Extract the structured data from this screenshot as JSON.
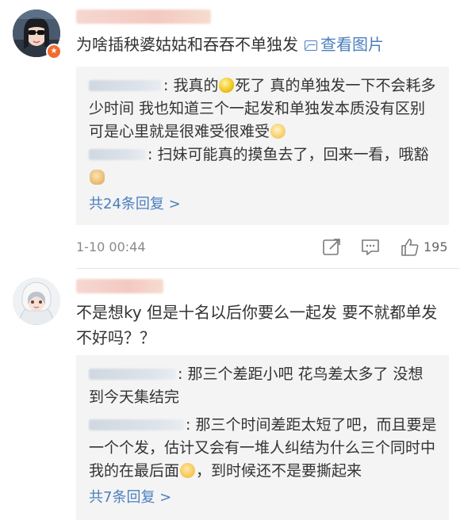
{
  "comments": [
    {
      "text": "为啥插秧婆姑姑和吞吞不单独发",
      "view_image_label": "查看图片",
      "replies": [
        {
          "text_before_emoji": "我真的",
          "emoji": "lemon-emoji",
          "text_after_emoji": "死了 真的单独发一下不会耗多少时间 我也知道三个一起发和单独发本质没有区别 可是心里就是很难受很难受",
          "emoji_end": "shy-emoji"
        },
        {
          "text": "扫妹可能真的摸鱼去了，回来一看，哦豁",
          "emoji_end": "doge-emoji"
        }
      ],
      "more_replies": "共24条回复 >",
      "timestamp": "1-10 00:44",
      "like_count": "195"
    },
    {
      "text": "不是想ky 但是十名以后你要么一起发 要不就都单发不好吗？？",
      "replies": [
        {
          "text": "那三个差距小吧 花鸟差太多了 没想到今天集结完"
        },
        {
          "text_before_emoji": "那三个时间差距太短了吧，而且要是一个个发，估计又会有一堆人纠结为什么三个同时中我的在最后面",
          "emoji": "drool-emoji",
          "text_after_emoji": "，到时候还不是要撕起来"
        }
      ],
      "more_replies": "共7条回复 >"
    }
  ],
  "colors": {
    "link": "#4b7fbf",
    "reply_bg": "#f4f4f4",
    "badge": "#f26a2e",
    "meta_text": "#8a8a8a"
  },
  "icons": [
    "share-icon",
    "comment-icon",
    "thumbs-up-icon",
    "image-icon"
  ]
}
